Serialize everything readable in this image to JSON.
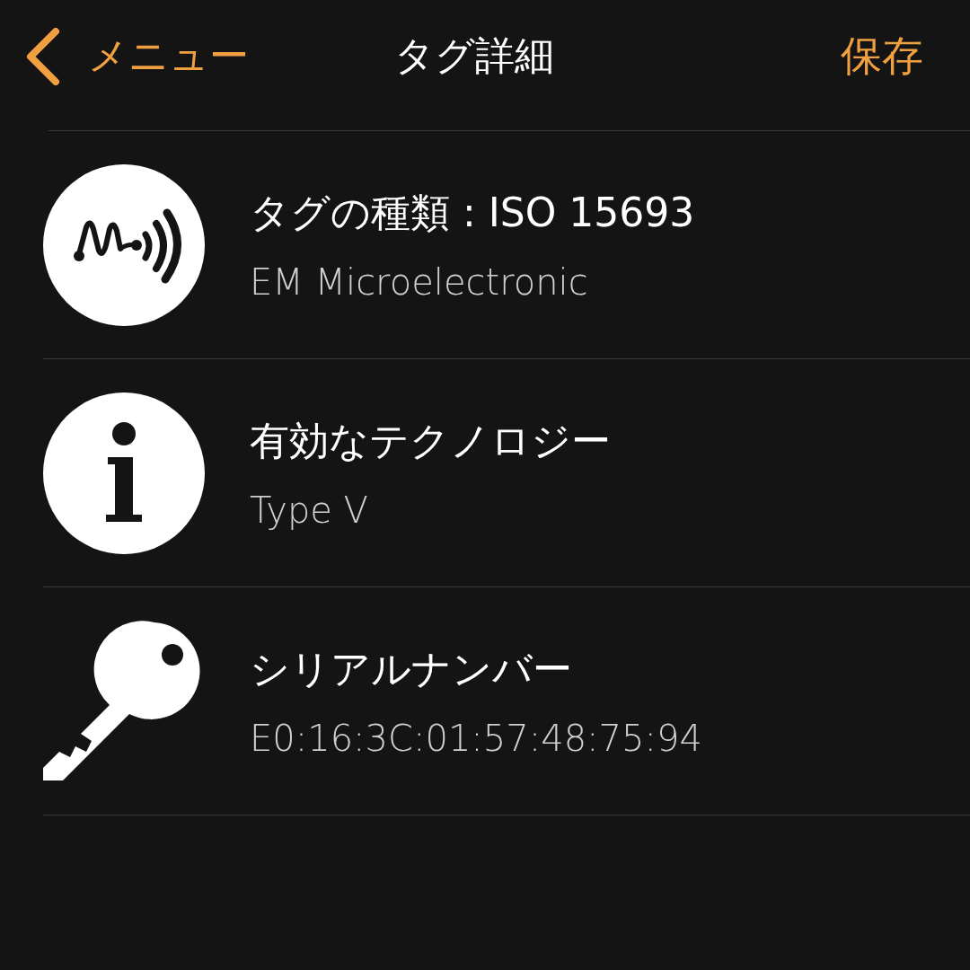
{
  "nav": {
    "back_label": "メニュー",
    "title": "タグ詳細",
    "action": "保存"
  },
  "rows": [
    {
      "kind": "tag",
      "title": "タグの種類 : ISO 15693",
      "subtitle": "EM Microelectronic"
    },
    {
      "kind": "info",
      "title": "有効なテクノロジー",
      "subtitle": "Type V"
    },
    {
      "kind": "key",
      "title": "シリアルナンバー",
      "subtitle": "E0:16:3C:01:57:48:75:94"
    }
  ]
}
